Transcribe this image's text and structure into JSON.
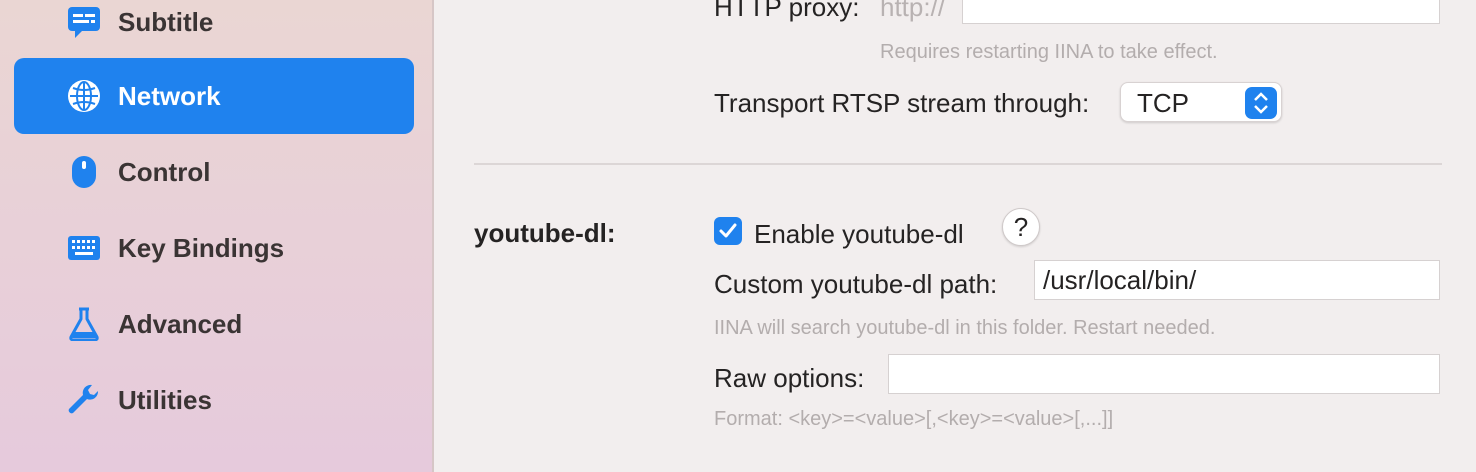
{
  "sidebar": {
    "items": [
      {
        "label": "Subtitle",
        "icon": "subtitle-icon"
      },
      {
        "label": "Network",
        "icon": "globe-icon",
        "active": true
      },
      {
        "label": "Control",
        "icon": "mouse-icon"
      },
      {
        "label": "Key Bindings",
        "icon": "keyboard-icon"
      },
      {
        "label": "Advanced",
        "icon": "flask-icon"
      },
      {
        "label": "Utilities",
        "icon": "wrench-icon"
      }
    ],
    "accent_color": "#1f82ee"
  },
  "network": {
    "http_proxy_label": "HTTP proxy:",
    "http_proxy_prefix": "http://",
    "http_proxy_value": "",
    "http_proxy_hint": "Requires restarting IINA to take effect.",
    "rtsp_label": "Transport RTSP stream through:",
    "rtsp_value": "TCP"
  },
  "youtube_dl": {
    "section_label": "youtube-dl:",
    "enable_label": "Enable youtube-dl",
    "enabled": true,
    "help_label": "?",
    "custom_path_label": "Custom youtube-dl path:",
    "custom_path_value": "/usr/local/bin/",
    "custom_path_hint": "IINA will search youtube-dl in this folder. Restart needed.",
    "raw_options_label": "Raw options:",
    "raw_options_value": "",
    "raw_options_hint": "Format: <key>=<value>[,<key>=<value>[,...]]"
  }
}
